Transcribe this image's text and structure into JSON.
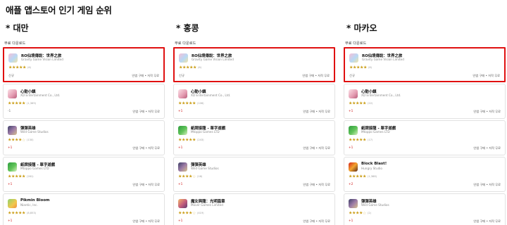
{
  "page_title": "애플 앱스토어 인기 게임 순위",
  "price_label": "인앱 구매 • 저작 무료",
  "columns": [
    {
      "region": "* 대만",
      "section_label": "무료 다운로드",
      "apps": [
        {
          "name": "RO仙境傳說：世界之旅",
          "developer": "Gravity Game Vision Limited",
          "rating": 5,
          "count": "(6)",
          "rank": "신규",
          "icon": "icon-ro"
        },
        {
          "name": "心動小鎮",
          "developer": "XD Entertainment Co., Ltd.",
          "rating": 5,
          "count": "(1,369)",
          "rank": "-1",
          "icon": "icon-xin"
        },
        {
          "name": "彈彈英雄",
          "developer": "Wild Game Studios",
          "rating": 4,
          "count": "(130)",
          "rank": "+1",
          "icon": "icon-dd"
        },
        {
          "name": "紙牌接龍 - 單字遊戲",
          "developer": "Mtoppo Games LTD",
          "rating": 5,
          "count": "(261)",
          "rank": "+1",
          "icon": "icon-zp"
        },
        {
          "name": "Pikmin Bloom",
          "developer": "Niantic, Inc.",
          "rating": 5,
          "count": "(8,853)",
          "rank": "+1",
          "icon": "icon-pk"
        }
      ]
    },
    {
      "region": "* 홍콩",
      "section_label": "무료 다운로드",
      "apps": [
        {
          "name": "RO仙境傳說：世界之旅",
          "developer": "Gravity Game Vision Limited",
          "rating": 5,
          "count": "(6)",
          "rank": "신규",
          "icon": "icon-ro"
        },
        {
          "name": "心動小鎮",
          "developer": "XD Entertainment Co., Ltd.",
          "rating": 5,
          "count": "(106)",
          "rank": "+1",
          "icon": "icon-xin"
        },
        {
          "name": "紙牌接龍 - 單字遊戲",
          "developer": "Mtoppo Games LTD",
          "rating": 5,
          "count": "(243)",
          "rank": "+1",
          "icon": "icon-zp"
        },
        {
          "name": "彈彈英雄",
          "developer": "Wild Game Studios",
          "rating": 4,
          "count": "(16)",
          "rank": "+1",
          "icon": "icon-dd"
        },
        {
          "name": "魔女與龍：光明篇章",
          "developer": "Mover Games Limited",
          "rating": 4,
          "count": "(419)",
          "rank": "+1",
          "icon": "icon-nw"
        }
      ]
    },
    {
      "region": "* 마카오",
      "section_label": "무료 다운로드",
      "apps": [
        {
          "name": "RO仙境傳說：世界之旅",
          "developer": "Gravity Game Vision Limited",
          "rating": 5,
          "count": "(8)",
          "rank": "신규",
          "icon": "icon-ro"
        },
        {
          "name": "心動小鎮",
          "developer": "XD Entertainment Co., Ltd.",
          "rating": 5,
          "count": "(22)",
          "rank": "+1",
          "icon": "icon-xin"
        },
        {
          "name": "紙牌接龍 - 單字遊戲",
          "developer": "Mtoppo Games LTD",
          "rating": 5,
          "count": "(17)",
          "rank": "+1",
          "icon": "icon-zp"
        },
        {
          "name": "Block Blast!",
          "developer": "Hungry Studio",
          "rating": 5,
          "count": "(1,388)",
          "rank": "+2",
          "icon": "icon-bb"
        },
        {
          "name": "彈彈英雄",
          "developer": "Wild Game Studios",
          "rating": 4,
          "count": "(2)",
          "rank": "+1",
          "icon": "icon-dd"
        }
      ]
    }
  ]
}
